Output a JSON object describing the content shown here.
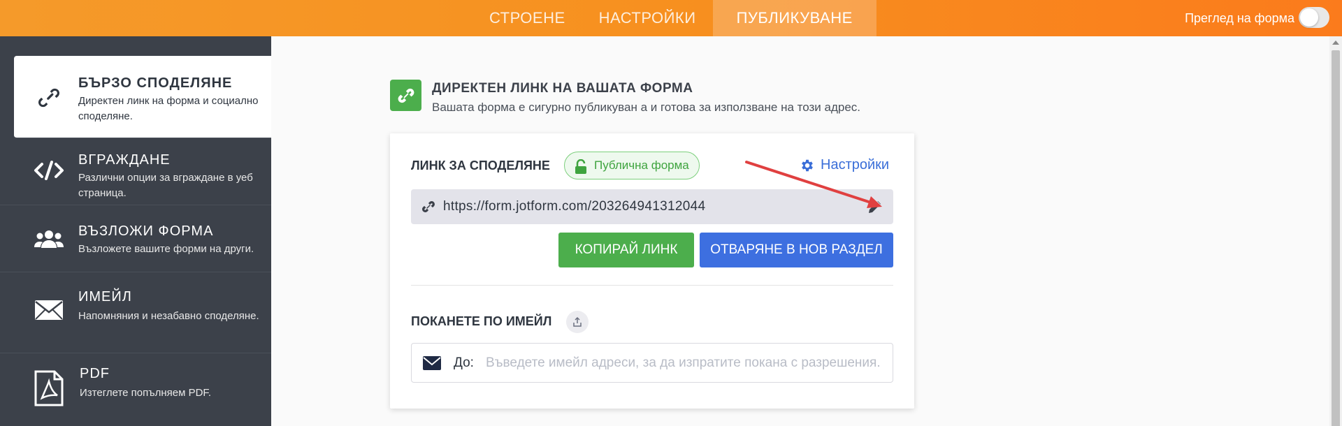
{
  "topbar": {
    "tabs": [
      {
        "label": "СТРОЕНЕ"
      },
      {
        "label": "НАСТРОЙКИ"
      },
      {
        "label": "ПУБЛИКУВАНЕ"
      }
    ],
    "preview_label": "Преглед на форма",
    "preview_toggle_on": false
  },
  "sidebar": {
    "items": [
      {
        "title": "БЪРЗО СПОДЕЛЯНЕ",
        "desc": "Директен линк на форма и социално споделяне.",
        "icon": "link-icon"
      },
      {
        "title": "ВГРАЖДАНЕ",
        "desc": "Различни опции за вграждане в уеб страница.",
        "icon": "code-icon"
      },
      {
        "title": "ВЪЗЛОЖИ ФОРМА",
        "desc": "Възложете вашите форми на други.",
        "icon": "users-icon"
      },
      {
        "title": "ИМЕЙЛ",
        "desc": "Напомняния и незабавно споделяне.",
        "icon": "envelope-icon"
      },
      {
        "title": "PDF",
        "desc": "Изтеглете попълняем PDF.",
        "icon": "pdf-icon"
      }
    ]
  },
  "main": {
    "title": "ДИРЕКТЕН ЛИНК НА ВАШАТА ФОРМА",
    "subtitle": "Вашата форма е сигурно публикуван а и готова за използване на този адрес.",
    "share_label": "ЛИНК ЗА СПОДЕЛЯНЕ",
    "badge": "Публична форма",
    "settings_label": "Настройки",
    "url": "https://form.jotform.com/203264941312044",
    "copy_button": "КОПИРАЙ ЛИНК",
    "open_button": "ОТВАРЯНЕ В НОВ РАЗДЕЛ",
    "invite_label": "ПОКАНЕТЕ ПО ИМЕЙЛ",
    "email_to_label": "До:",
    "email_placeholder": "Въведете имейл адреси, за да изпратите покана с разрешения."
  },
  "colors": {
    "accent_orange": "#f7901f",
    "sidebar_bg": "#3c414a",
    "green": "#4cae4c",
    "blue": "#3d6fe0",
    "annotation_red": "#e04040"
  }
}
